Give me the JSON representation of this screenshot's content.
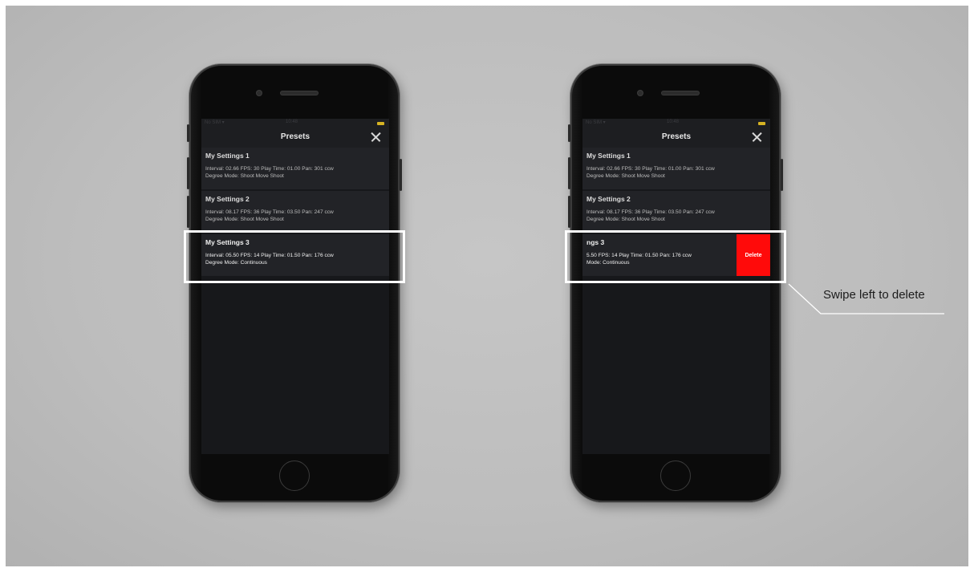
{
  "screens": [
    {
      "status": {
        "left": "No SIM ▾",
        "center": "10:48"
      },
      "nav_title": "Presets",
      "presets": [
        {
          "name": "My Settings 1",
          "line1": "Interval: 02.66 FPS: 30 Play Time: 01.00  Pan: 301 ccw",
          "line2": "Degree  Mode: Shoot Move Shoot"
        },
        {
          "name": "My Settings 2",
          "line1": "Interval: 08.17 FPS: 36 Play Time: 03.50  Pan: 247 ccw",
          "line2": "Degree  Mode: Shoot Move Shoot"
        },
        {
          "name": "My Settings 3",
          "line1": "Interval: 05.50 FPS: 14 Play Time: 01.50  Pan: 176 ccw",
          "line2": "Degree  Mode: Continuous"
        }
      ]
    },
    {
      "status": {
        "left": "No SIM ▾",
        "center": "10:48"
      },
      "nav_title": "Presets",
      "presets": [
        {
          "name": "My Settings 1",
          "line1": "Interval: 02.66 FPS: 30 Play Time: 01.00  Pan: 301 ccw",
          "line2": "Degree  Mode: Shoot Move Shoot"
        },
        {
          "name": "My Settings 2",
          "line1": "Interval: 08.17 FPS: 36 Play Time: 03.50  Pan: 247 ccw",
          "line2": "Degree  Mode: Shoot Move Shoot"
        },
        {
          "name": "ngs 3",
          "line1": "5.50 FPS: 14 Play Time: 01.50  Pan: 176 ccw",
          "line2": "Mode: Continuous"
        }
      ],
      "delete_label": "Delete"
    }
  ],
  "callout": {
    "text": "Swipe left to delete"
  },
  "colors": {
    "delete": "#ff0a0a",
    "battery": "#d6b323",
    "highlight": "#ffffff",
    "screen_bg": "#17181b"
  }
}
